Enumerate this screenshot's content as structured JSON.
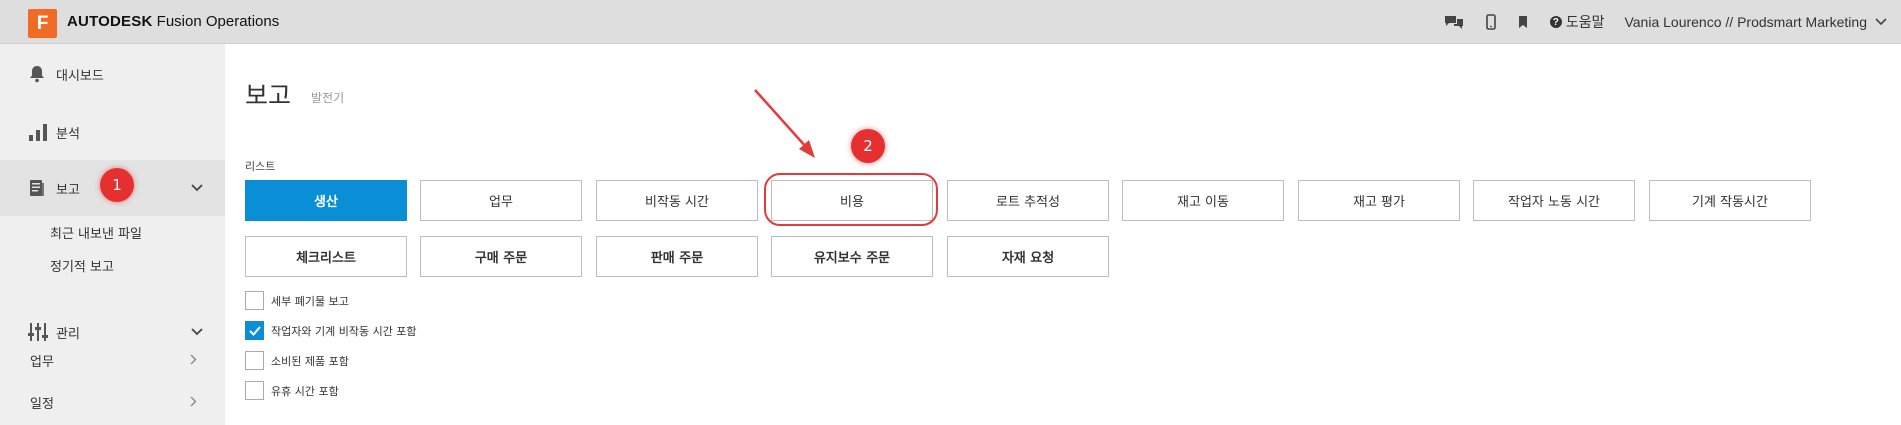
{
  "header": {
    "logo_letter": "F",
    "brand_bold": "AUTODESK",
    "brand_product": "Fusion Operations",
    "help_label": "도움말",
    "user_label": "Vania Lourenco // Prodsmart Marketing"
  },
  "sidebar": {
    "dashboard": "대시보드",
    "analysis": "분석",
    "reports": "보고",
    "recent_exports": "최근 내보낸 파일",
    "scheduled_reports": "정기적 보고",
    "manage": "관리",
    "work": "업무",
    "schedule": "일정"
  },
  "main": {
    "title": "보고",
    "subtitle": "발전기",
    "section_label": "리스트",
    "buttons_row1": [
      "생산",
      "업무",
      "비작동 시간",
      "비용",
      "로트 추적성",
      "재고 이동",
      "재고 평가",
      "작업자 노동 시간",
      "기계 작동시간"
    ],
    "buttons_row2": [
      "체크리스트",
      "구매 주문",
      "판매 주문",
      "유지보수 주문",
      "자재 요청"
    ],
    "checkboxes": [
      {
        "label": "세부 폐기물 보고",
        "checked": false
      },
      {
        "label": "작업자와 기계 비작동 시간 포함",
        "checked": true
      },
      {
        "label": "소비된 제품 포함",
        "checked": false
      },
      {
        "label": "유휴 시간 포함",
        "checked": false
      }
    ],
    "active_button": "생산"
  },
  "annotations": {
    "badge1": "1",
    "badge2": "2",
    "color": "#e63030"
  },
  "colors": {
    "accent": "#0a8fd6",
    "logo": "#f26b24",
    "topbar": "#dedede",
    "sidebar": "#efefef"
  }
}
